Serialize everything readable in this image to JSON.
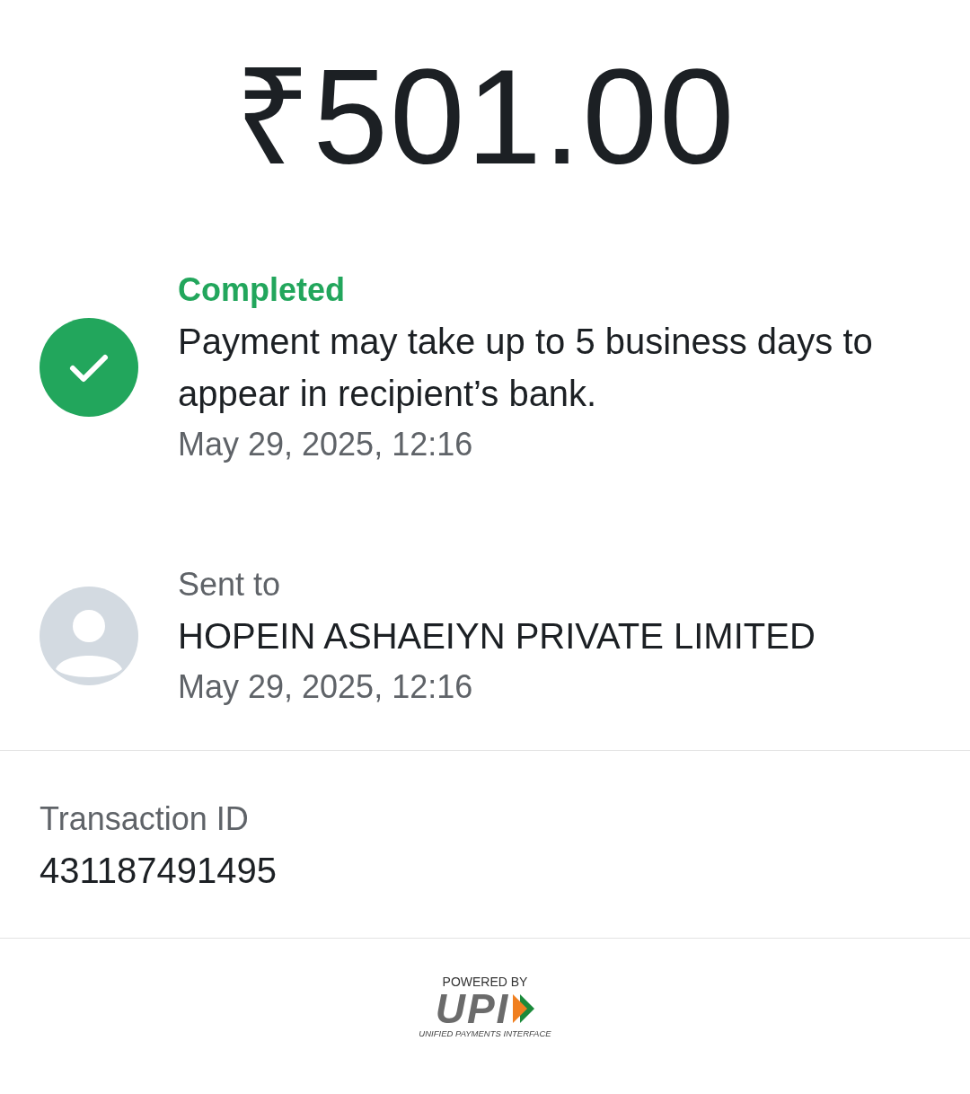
{
  "amount": "₹501.00",
  "status": {
    "kind": "completed",
    "label": "Completed",
    "message": "Payment may take up to 5 business days to appear in recipient’s bank.",
    "time": "May 29, 2025, 12:16"
  },
  "recipient": {
    "label": "Sent to",
    "name": "HOPEIN ASHAEIYN PRIVATE LIMITED",
    "time": "May 29, 2025, 12:16"
  },
  "transaction": {
    "label": "Transaction ID",
    "value": "431187491495"
  },
  "footer": {
    "powered_by": "POWERED BY",
    "logo": "UPI",
    "tagline": "UNIFIED PAYMENTS INTERFACE"
  }
}
